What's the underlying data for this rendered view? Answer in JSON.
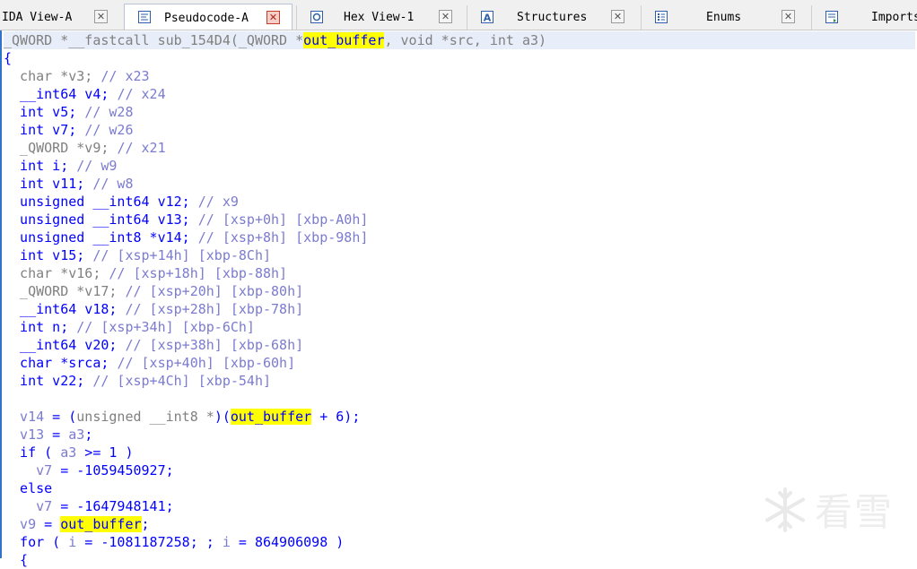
{
  "tabs": [
    {
      "label": "IDA View-A",
      "icon": "ida-view-icon",
      "active": false
    },
    {
      "label": "Pseudocode-A",
      "icon": "pseudocode-icon",
      "active": true
    },
    {
      "label": "Hex View-1",
      "icon": "hex-view-icon",
      "active": false
    },
    {
      "label": "Structures",
      "icon": "structures-icon",
      "active": false
    },
    {
      "label": "Enums",
      "icon": "enums-icon",
      "active": false
    },
    {
      "label": "Imports",
      "icon": "imports-icon",
      "active": false
    }
  ],
  "colors": {
    "keyword": "#0000ff",
    "comment": "#7b7bd0",
    "gray": "#808080",
    "highlight": "#ffff00",
    "accent": "#2f74c9"
  },
  "code": {
    "signature": [
      {
        "t": "_QWORD *__fastcall sub_154D4(_QWORD *",
        "c": "gray"
      },
      {
        "t": "out_buffer",
        "c": "hl"
      },
      {
        "t": ", void *src, int a3)",
        "c": "gray"
      }
    ],
    "lines": [
      [
        {
          "t": "{",
          "c": "blue"
        }
      ],
      [
        {
          "t": "  char *v3; ",
          "c": "gray"
        },
        {
          "t": "// x23",
          "c": "lav"
        }
      ],
      [
        {
          "t": "  __int64 v4; ",
          "c": "blue"
        },
        {
          "t": "// x24",
          "c": "lav"
        }
      ],
      [
        {
          "t": "  int v5; ",
          "c": "blue"
        },
        {
          "t": "// w28",
          "c": "lav"
        }
      ],
      [
        {
          "t": "  int v7; ",
          "c": "blue"
        },
        {
          "t": "// w26",
          "c": "lav"
        }
      ],
      [
        {
          "t": "  _QWORD *v9; ",
          "c": "gray"
        },
        {
          "t": "// x21",
          "c": "lav"
        }
      ],
      [
        {
          "t": "  int i; ",
          "c": "blue"
        },
        {
          "t": "// w9",
          "c": "lav"
        }
      ],
      [
        {
          "t": "  int v11; ",
          "c": "blue"
        },
        {
          "t": "// w8",
          "c": "lav"
        }
      ],
      [
        {
          "t": "  unsigned __int64 v12; ",
          "c": "blue"
        },
        {
          "t": "// x9",
          "c": "lav"
        }
      ],
      [
        {
          "t": "  unsigned __int64 v13; ",
          "c": "blue"
        },
        {
          "t": "// [xsp+0h] [xbp-A0h]",
          "c": "lav"
        }
      ],
      [
        {
          "t": "  unsigned __int8 *v14; ",
          "c": "blue"
        },
        {
          "t": "// [xsp+8h] [xbp-98h]",
          "c": "lav"
        }
      ],
      [
        {
          "t": "  int v15; ",
          "c": "blue"
        },
        {
          "t": "// [xsp+14h] [xbp-8Ch]",
          "c": "lav"
        }
      ],
      [
        {
          "t": "  char *v16; ",
          "c": "gray"
        },
        {
          "t": "// [xsp+18h] [xbp-88h]",
          "c": "lav"
        }
      ],
      [
        {
          "t": "  _QWORD *v17; ",
          "c": "gray"
        },
        {
          "t": "// [xsp+20h] [xbp-80h]",
          "c": "lav"
        }
      ],
      [
        {
          "t": "  __int64 v18; ",
          "c": "blue"
        },
        {
          "t": "// [xsp+28h] [xbp-78h]",
          "c": "lav"
        }
      ],
      [
        {
          "t": "  int n; ",
          "c": "blue"
        },
        {
          "t": "// [xsp+34h] [xbp-6Ch]",
          "c": "lav"
        }
      ],
      [
        {
          "t": "  __int64 v20; ",
          "c": "blue"
        },
        {
          "t": "// [xsp+38h] [xbp-68h]",
          "c": "lav"
        }
      ],
      [
        {
          "t": "  char *srca; ",
          "c": "blue"
        },
        {
          "t": "// [xsp+40h] [xbp-60h]",
          "c": "lav"
        }
      ],
      [
        {
          "t": "  int v22; ",
          "c": "blue"
        },
        {
          "t": "// [xsp+4Ch] [xbp-54h]",
          "c": "lav"
        }
      ],
      [],
      [
        {
          "t": "  v14",
          "c": "lav"
        },
        {
          "t": " = (",
          "c": "blue"
        },
        {
          "t": "unsigned __int8 *",
          "c": "gray"
        },
        {
          "t": ")(",
          "c": "blue"
        },
        {
          "t": "out_buffer",
          "c": "hl"
        },
        {
          "t": " + 6);",
          "c": "blue"
        }
      ],
      [
        {
          "t": "  v13",
          "c": "lav"
        },
        {
          "t": " = ",
          "c": "blue"
        },
        {
          "t": "a3",
          "c": "lav"
        },
        {
          "t": ";",
          "c": "blue"
        }
      ],
      [
        {
          "t": "  if ( ",
          "c": "blue"
        },
        {
          "t": "a3",
          "c": "lav"
        },
        {
          "t": " >= 1 )",
          "c": "blue"
        }
      ],
      [
        {
          "t": "    v7",
          "c": "lav"
        },
        {
          "t": " = -1059450927;",
          "c": "blue"
        }
      ],
      [
        {
          "t": "  else",
          "c": "blue"
        }
      ],
      [
        {
          "t": "    v7",
          "c": "lav"
        },
        {
          "t": " = -1647948141;",
          "c": "blue"
        }
      ],
      [
        {
          "t": "  v9",
          "c": "lav"
        },
        {
          "t": " = ",
          "c": "blue"
        },
        {
          "t": "out_buffer",
          "c": "hl"
        },
        {
          "t": ";",
          "c": "blue"
        }
      ],
      [
        {
          "t": "  for ( ",
          "c": "blue"
        },
        {
          "t": "i",
          "c": "lav"
        },
        {
          "t": " = -1081187258; ; ",
          "c": "blue"
        },
        {
          "t": "i",
          "c": "lav"
        },
        {
          "t": " = 864906098 )",
          "c": "blue"
        }
      ],
      [
        {
          "t": "  {",
          "c": "blue"
        }
      ]
    ]
  },
  "watermark": {
    "text": "看雪",
    "icon": "snowflake-icon"
  }
}
